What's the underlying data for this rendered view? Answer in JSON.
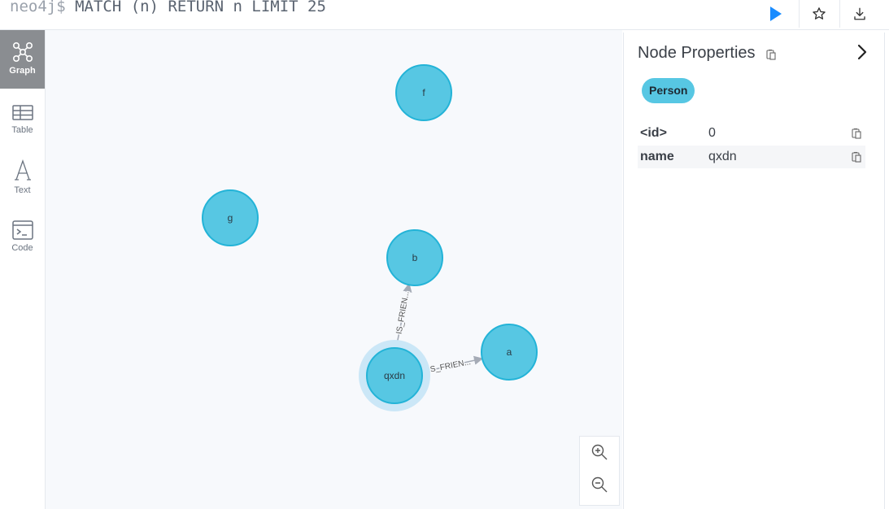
{
  "editor": {
    "prompt": "neo4j$",
    "query": " MATCH (n) RETURN n LIMIT 25"
  },
  "toolbar": {
    "run_icon": "play-icon",
    "favorite_icon": "star-icon",
    "download_icon": "download-icon",
    "accent_color": "#1a8cff"
  },
  "sidebar": {
    "items": [
      {
        "label": "Graph",
        "icon": "graph-icon",
        "active": true
      },
      {
        "label": "Table",
        "icon": "table-icon",
        "active": false
      },
      {
        "label": "Text",
        "icon": "text-icon",
        "active": false
      },
      {
        "label": "Code",
        "icon": "code-icon",
        "active": false
      }
    ]
  },
  "graph": {
    "node_color": "#57c7e3",
    "node_border": "#23b3d7",
    "selected_halo": "#cbe7f7",
    "nodes": [
      {
        "id": "f",
        "label": "f"
      },
      {
        "id": "g",
        "label": "g"
      },
      {
        "id": "b",
        "label": "b"
      },
      {
        "id": "qxdn",
        "label": "qxdn",
        "selected": true
      },
      {
        "id": "a",
        "label": "a"
      }
    ],
    "relationships": [
      {
        "from": "qxdn",
        "to": "b",
        "label": "IS_FRIEN..."
      },
      {
        "from": "qxdn",
        "to": "a",
        "label": "IS_FRIEN..."
      }
    ]
  },
  "zoom": {
    "in_icon": "zoom-in-icon",
    "out_icon": "zoom-out-icon"
  },
  "panel": {
    "title": "Node Properties",
    "node_label": "Person",
    "properties": [
      {
        "key": "<id>",
        "value": "0"
      },
      {
        "key": "name",
        "value": "qxdn"
      }
    ]
  }
}
